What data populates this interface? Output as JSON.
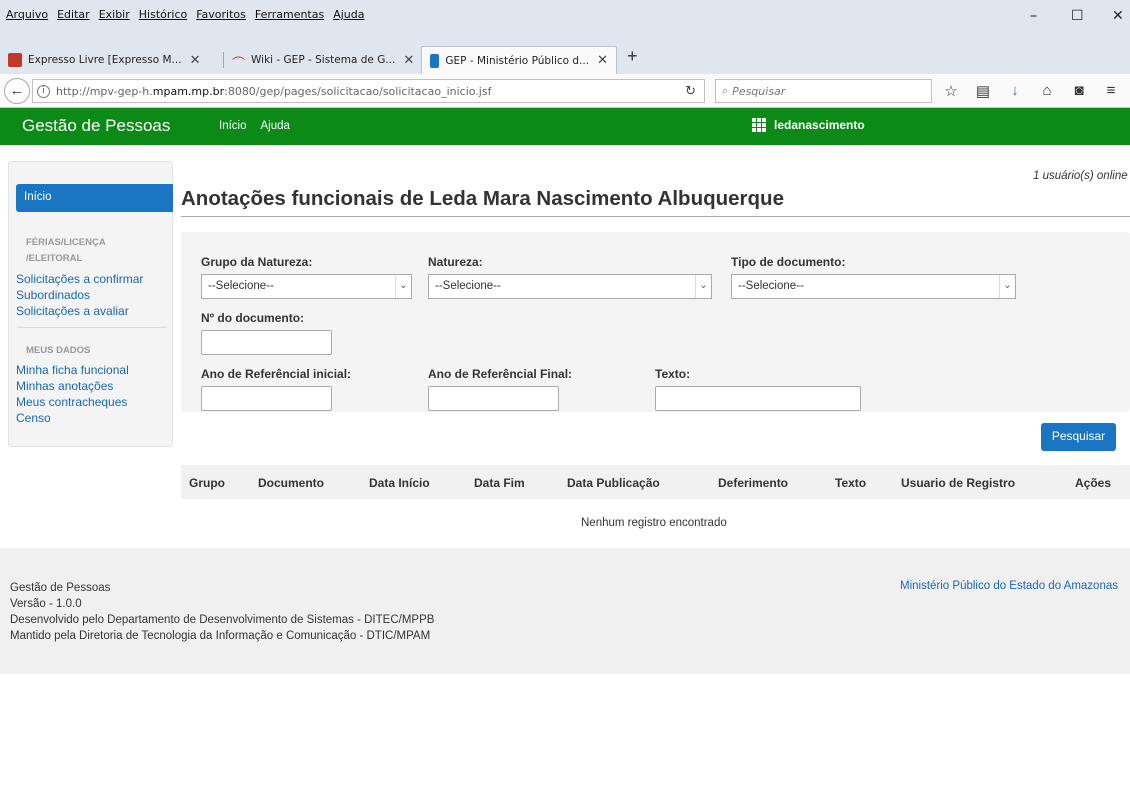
{
  "browser": {
    "menu": [
      "Arquivo",
      "Editar",
      "Exibir",
      "Histórico",
      "Favoritos",
      "Ferramentas",
      "Ajuda"
    ],
    "window_controls": [
      "–",
      "☐",
      "✕"
    ],
    "tabs": [
      {
        "label": "Expresso Livre [Expresso M...",
        "icon_color": "#c0392b"
      },
      {
        "label": "Wiki - GEP - Sistema de G...",
        "icon_color": "#c0392b"
      },
      {
        "label": "GEP - Ministério Público d...",
        "icon_color": "#1a76c2"
      }
    ],
    "newtab_label": "+",
    "url_prefix": "http://mpv-gep-h.",
    "url_host": "mpam.mp.br",
    "url_suffix": ":8080/gep/pages/solicitacao/solicitacao_inicio.jsf",
    "search_placeholder": "Pesquisar"
  },
  "app": {
    "brand": "Gestão de Pessoas",
    "nav": [
      "Início",
      "Ajuda"
    ],
    "username": "ledanascimento",
    "header_color": "#0c8a17",
    "accent_color": "#1a76c2"
  },
  "sidebar": {
    "active_item": "Início",
    "section1": "FÉRIAS/LICENÇA /ELEITORAL",
    "section1_items": [
      "Solicitações a confirmar",
      "Subordinados",
      "Solicitações a avaliar"
    ],
    "section2": "MEUS DADOS",
    "section2_items": [
      "Minha ficha funcional",
      "Minhas anotações",
      "Meus contracheques",
      "Censo"
    ]
  },
  "main": {
    "online": "1 usuário(s) online",
    "title": "Anotações funcionais de Leda Mara Nascimento Albuquerque",
    "form": {
      "grupo_label": "Grupo da Natureza:",
      "grupo_value": "--Selecione--",
      "natureza_label": "Natureza:",
      "natureza_value": "--Selecione--",
      "tipo_label": "Tipo de documento:",
      "tipo_value": "--Selecione--",
      "numero_label": "Nº do documento:",
      "ano_ini_label": "Ano de Referêncial inicial:",
      "ano_fim_label": "Ano de Referêncial Final:",
      "texto_label": "Texto:"
    },
    "search_button": "Pesquisar",
    "table_headers": [
      "Grupo",
      "Documento",
      "Data Início",
      "Data Fim",
      "Data Publicação",
      "Deferimento",
      "Texto",
      "Usuario de Registro",
      "Ações"
    ],
    "empty_message": "Nenhum registro encontrado"
  },
  "footer": {
    "lines": [
      "Gestão de Pessoas",
      "Versão - 1.0.0",
      "Desenvolvido pelo Departamento de Desenvolvimento de Sistemas - DITEC/MPPB",
      "Mantido pela Diretoria de Tecnologia da Informação e Comunicação - DTIC/MPAM"
    ],
    "right_link": "Ministério Público do Estado do Amazonas"
  }
}
